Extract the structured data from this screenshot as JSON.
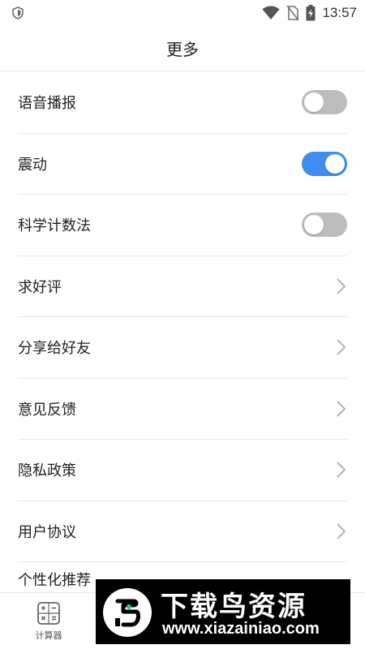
{
  "status_bar": {
    "time": "13:57",
    "icons": [
      "shield-icon",
      "wifi-icon",
      "no-sim-icon",
      "battery-charging-icon"
    ]
  },
  "header": {
    "title": "更多"
  },
  "settings": {
    "items": [
      {
        "label": "语音播报",
        "control": "toggle",
        "on": false
      },
      {
        "label": "震动",
        "control": "toggle",
        "on": true
      },
      {
        "label": "科学计数法",
        "control": "toggle",
        "on": false
      },
      {
        "label": "求好评",
        "control": "chevron"
      },
      {
        "label": "分享给好友",
        "control": "chevron"
      },
      {
        "label": "意见反馈",
        "control": "chevron"
      },
      {
        "label": "隐私政策",
        "control": "chevron"
      },
      {
        "label": "用户协议",
        "control": "chevron"
      },
      {
        "label": "个性化推荐",
        "control": "none"
      }
    ]
  },
  "bottom_nav": {
    "calculator_label": "计算器",
    "calculator_icon": "calculator-icon"
  },
  "watermark": {
    "title": "下载鸟资源",
    "url": "www.xiazainiao.com"
  },
  "colors": {
    "accent": "#3d8ef0",
    "toggle_off": "#bdbdbd",
    "divider": "#e8e8e8"
  }
}
